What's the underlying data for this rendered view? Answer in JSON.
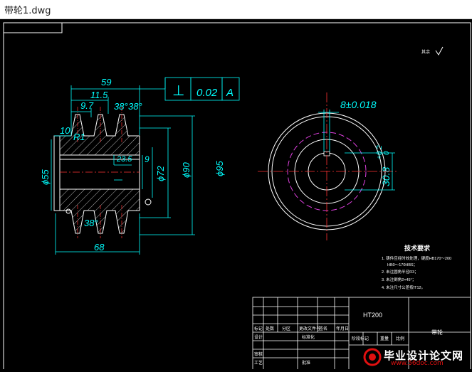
{
  "window": {
    "title": "带轮1.dwg"
  },
  "drawing": {
    "roughness_note": "其余",
    "dims": {
      "d59": "59",
      "d11_5": "11.5",
      "d9_7": "9.7",
      "angle_top": "38°",
      "angle_top2": "38°",
      "r1": "R1",
      "d10": "10",
      "d55": "ϕ55",
      "d23_5": "23.5",
      "d9": "9",
      "d72": "ϕ72",
      "d90": "ϕ90",
      "d95": "ϕ95",
      "d68": "68",
      "angle_bottom": "38°",
      "tol_symbol": "⊥",
      "tol_value": "0.02",
      "tol_datum": "A",
      "keyway": "8±0.018",
      "hub": "30.8",
      "hub_tol": "+0.2",
      "hub_tol2": "0",
      "datum_label": "A"
    },
    "notes": {
      "title": "技术要求",
      "items": [
        "1. 铸件应经时效处理，硬度HB170～200",
        "HB0～170HBS；",
        "2. 未注圆角半径R3；",
        "3. 未注倒角2×45°；",
        "4. 未注尺寸公差按IT12。"
      ]
    },
    "title_block": {
      "material": "HT200",
      "cells": [
        "标记",
        "处数",
        "分区",
        "更改文件号",
        "签名",
        "年月日",
        "设计",
        "标准化",
        "阶段标记",
        "重量",
        "比例",
        "审核",
        "工艺",
        "批准",
        "带轮"
      ]
    }
  },
  "watermark": {
    "text": "毕业设计论文网",
    "url": "www.56doc.com"
  }
}
